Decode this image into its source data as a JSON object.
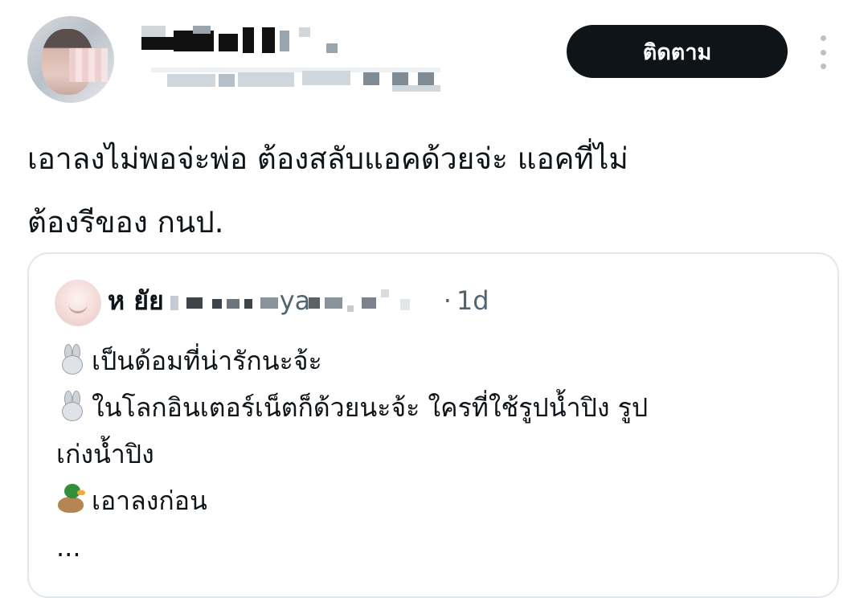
{
  "header": {
    "follow_label": "ติดตาม"
  },
  "tweet": {
    "text_line1": "เอาลงไม่พอจ่ะพ่อ  ต้องสลับแอคด้วยจ่ะ แอคที่ไม่",
    "text_line2": "ต้องรีของ กนป."
  },
  "quote": {
    "name_visible": "ห ยัย",
    "handle_visible": "ya",
    "separator": "·",
    "time": "1d",
    "lines": [
      {
        "emoji": "rabbit-icon",
        "text": "เป็นด้อมที่น่ารักนะจ้ะ"
      },
      {
        "emoji": "rabbit-icon",
        "text": "ในโลกอินเตอร์เน็ตก็ด้วยนะจ้ะ ใครที่ใช้รูปน้ำปิง รูป"
      },
      {
        "emoji": "",
        "text": "เก่งน้ำปิง"
      },
      {
        "emoji": "duck-icon",
        "text": "เอาลงก่อน"
      },
      {
        "emoji": "",
        "text": "..."
      }
    ]
  }
}
